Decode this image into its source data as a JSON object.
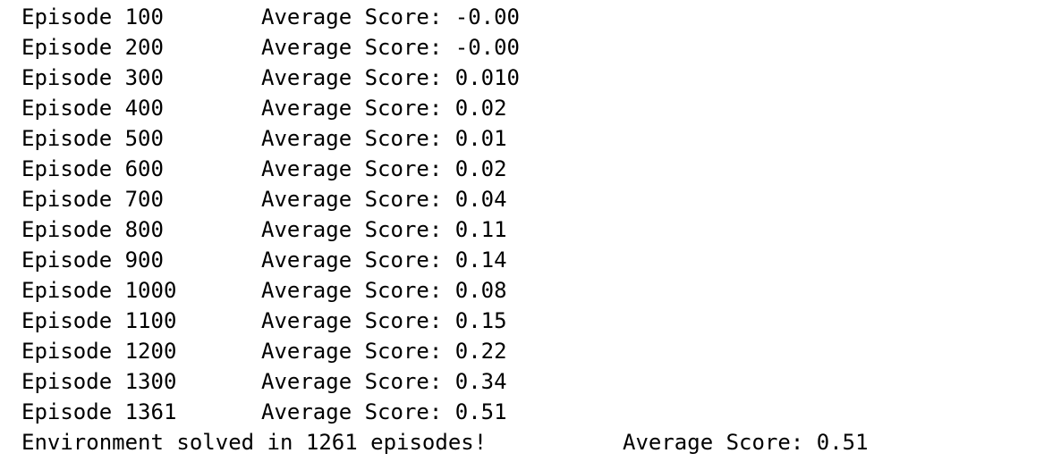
{
  "log_lines": [
    {
      "episode": "Episode 100",
      "score": "Average Score: -0.00"
    },
    {
      "episode": "Episode 200",
      "score": "Average Score: -0.00"
    },
    {
      "episode": "Episode 300",
      "score": "Average Score: 0.010"
    },
    {
      "episode": "Episode 400",
      "score": "Average Score: 0.02"
    },
    {
      "episode": "Episode 500",
      "score": "Average Score: 0.01"
    },
    {
      "episode": "Episode 600",
      "score": "Average Score: 0.02"
    },
    {
      "episode": "Episode 700",
      "score": "Average Score: 0.04"
    },
    {
      "episode": "Episode 800",
      "score": "Average Score: 0.11"
    },
    {
      "episode": "Episode 900",
      "score": "Average Score: 0.14"
    },
    {
      "episode": "Episode 1000",
      "score": "Average Score: 0.08"
    },
    {
      "episode": "Episode 1100",
      "score": "Average Score: 0.15"
    },
    {
      "episode": "Episode 1200",
      "score": "Average Score: 0.22"
    },
    {
      "episode": "Episode 1300",
      "score": "Average Score: 0.34"
    },
    {
      "episode": "Episode 1361",
      "score": "Average Score: 0.51"
    }
  ],
  "summary": {
    "solved": "Environment solved in 1261 episodes!",
    "score": "Average Score: 0.51"
  }
}
